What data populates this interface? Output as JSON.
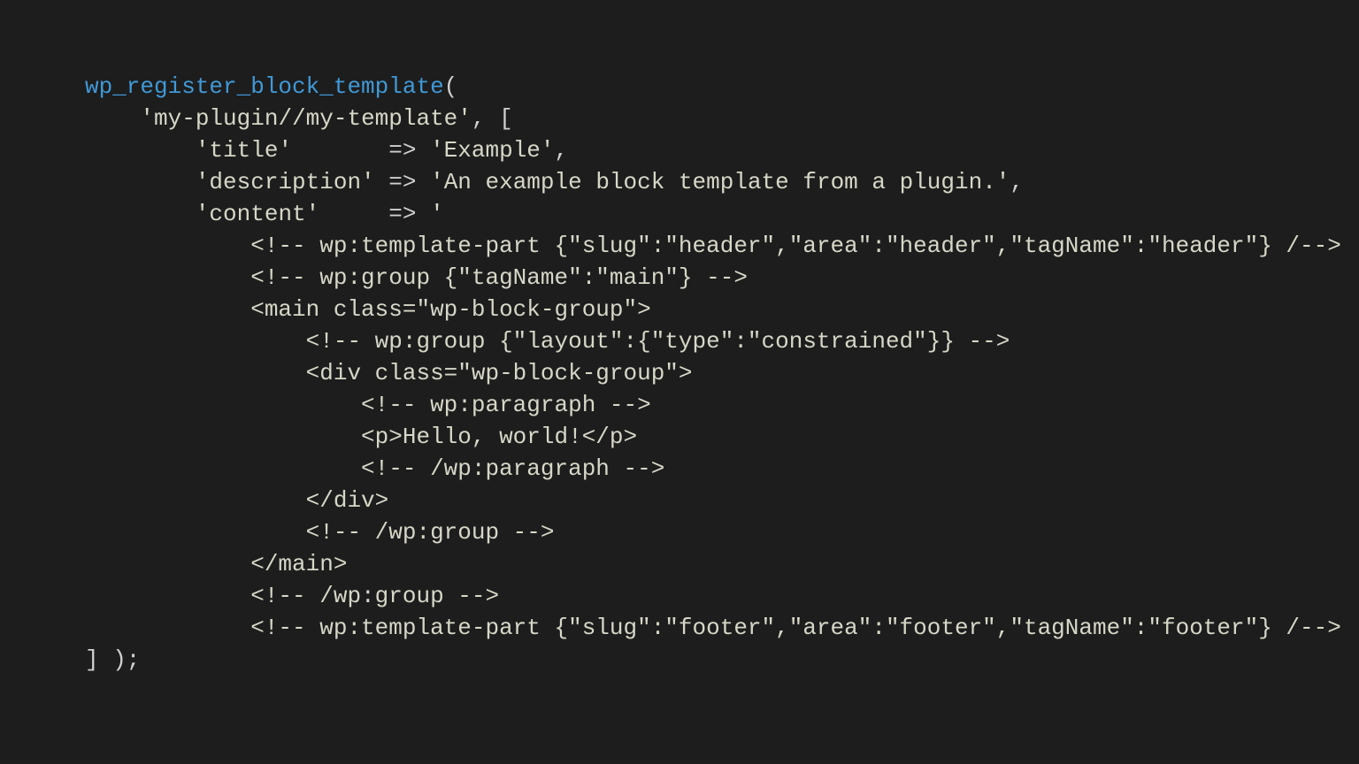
{
  "code": {
    "fn": "wp_register_block_template",
    "open_paren": "(",
    "l2_a": "    ",
    "l2_b": "'my-plugin//my-template'",
    "l2_c": ", [",
    "l3_a": "        ",
    "l3_b": "'title'",
    "l3_c": "       => ",
    "l3_d": "'Example'",
    "l3_e": ",",
    "l4_a": "        ",
    "l4_b": "'description'",
    "l4_c": " => ",
    "l4_d": "'An example block template from a plugin.'",
    "l4_e": ",",
    "l5_a": "        ",
    "l5_b": "'content'",
    "l5_c": "     => ",
    "l5_d": "'",
    "l6": "            <!-- wp:template-part {\"slug\":\"header\",\"area\":\"header\",\"tagName\":\"header\"} /-->",
    "l7": "            <!-- wp:group {\"tagName\":\"main\"} -->",
    "l8": "            <main class=\"wp-block-group\">",
    "l9": "                <!-- wp:group {\"layout\":{\"type\":\"constrained\"}} -->",
    "l10": "                <div class=\"wp-block-group\">",
    "l11": "                    <!-- wp:paragraph -->",
    "l12": "                    <p>Hello, world!</p>",
    "l13": "                    <!-- /wp:paragraph -->",
    "l14": "                </div>",
    "l15": "                <!-- /wp:group -->",
    "l16": "            </main>",
    "l17": "            <!-- /wp:group -->",
    "l18": "            <!-- wp:template-part {\"slug\":\"footer\",\"area\":\"footer\",\"tagName\":\"footer\"} /-->",
    "l19": "] );"
  }
}
